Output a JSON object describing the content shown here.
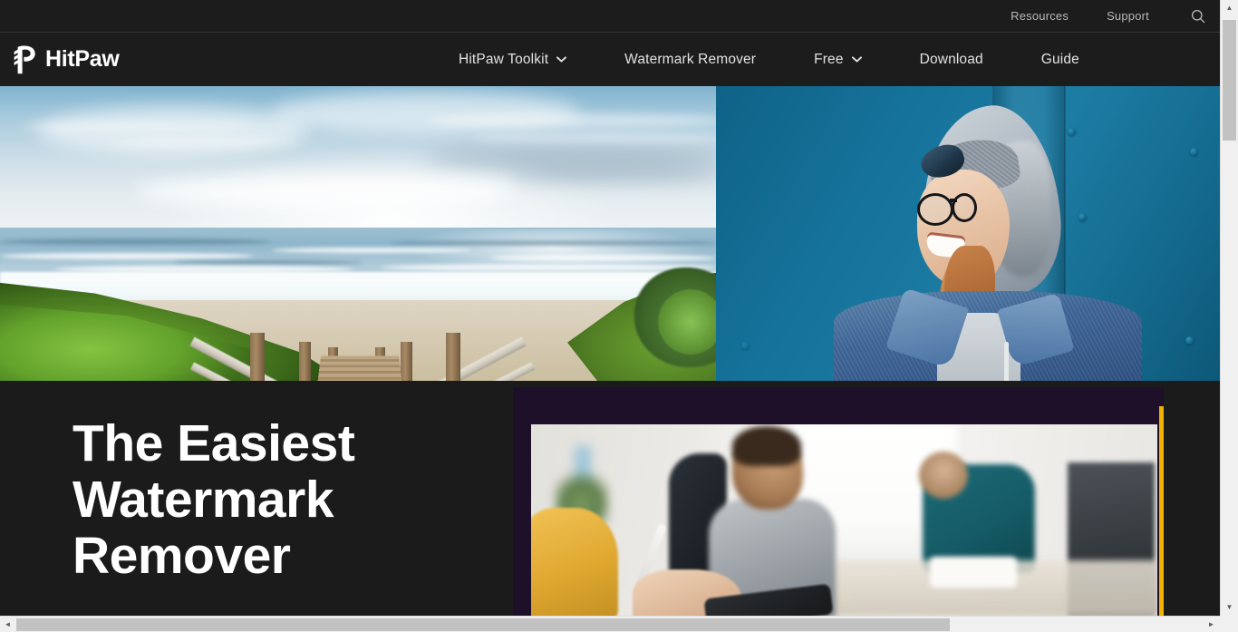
{
  "topbar": {
    "links": [
      {
        "label": "Resources",
        "name": "resources"
      },
      {
        "label": "Support",
        "name": "support"
      }
    ],
    "search_icon": "search-icon"
  },
  "header": {
    "brand": {
      "name": "HitPaw",
      "logo_icon": "hitpaw-paw-logo-icon"
    },
    "nav": [
      {
        "label": "HitPaw Toolkit",
        "has_dropdown": true,
        "icon": "chevron-down-icon"
      },
      {
        "label": "Watermark Remover",
        "has_dropdown": false,
        "icon": ""
      },
      {
        "label": "Free",
        "has_dropdown": true,
        "icon": "chevron-down-icon"
      },
      {
        "label": "Download",
        "has_dropdown": false,
        "icon": ""
      },
      {
        "label": "Guide",
        "has_dropdown": false,
        "icon": ""
      }
    ]
  },
  "banner": {
    "left_image": {
      "name": "beach-boardwalk-photo",
      "alt": "Wooden boardwalk stairs leading down to a sunny beach with ocean and green dune grass"
    },
    "right_image": {
      "name": "smiling-woman-photo",
      "alt": "Smiling woman in denim jacket, grey hood and glasses in front of a teal blue metal wall"
    }
  },
  "hero": {
    "headline": "The Easiest\nWatermark\nRemover",
    "promo_image": {
      "name": "office-stylus-photo",
      "alt": "Close-up of a hand holding a stylus over a tablet in a blurred bright office with colleagues"
    },
    "accent_color": "#f2b000",
    "panel_color": "#1d1028"
  },
  "colors": {
    "page_background": "#1b1b1b",
    "header_background": "#1c1c1c",
    "nav_text": "#e2e2e2",
    "topbar_text": "#b9b9b9",
    "headline_text": "#ffffff",
    "accent_gold": "#f2b000",
    "promo_panel_purple": "#1d1028",
    "scrollbar_track": "#f0f0f0",
    "scrollbar_thumb": "#c2c2c2"
  },
  "scrollbars": {
    "vertical": {
      "up_arrow": "▲",
      "down_arrow": "▼",
      "name": "vertical-scrollbar"
    },
    "horizontal": {
      "left_arrow": "◄",
      "right_arrow": "►",
      "name": "horizontal-scrollbar"
    }
  }
}
